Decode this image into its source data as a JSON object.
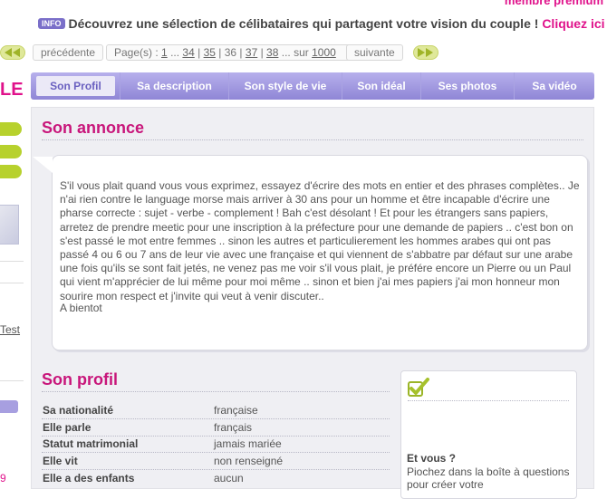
{
  "header": {
    "member_label": "membre premium"
  },
  "promo": {
    "badge": "INFO",
    "text": "Découvrez une sélection de célibataires qui partagent votre vision du couple ! ",
    "link": "Cliquez ici"
  },
  "pager": {
    "prev": "précédente",
    "pages_label": "Page(s) : ",
    "pages": [
      "1",
      "...",
      "34",
      "35",
      "36",
      "37",
      "38",
      "..."
    ],
    "of_label": "sur",
    "total": "1000",
    "next": "suivante"
  },
  "sidebar": {
    "title_fragment": "LE",
    "test_link": "Test",
    "number_fragment": "9"
  },
  "tabs": [
    {
      "label": "Son Profil",
      "active": true
    },
    {
      "label": "Sa description"
    },
    {
      "label": "Son style de vie"
    },
    {
      "label": "Son idéal"
    },
    {
      "label": "Ses photos"
    },
    {
      "label": "Sa vidéo"
    }
  ],
  "annonce": {
    "heading": "Son annonce",
    "text": "S'il vous plait quand vous vous exprimez, essayez d'écrire des mots en entier et des phrases complètes.. Je n'ai rien contre le language morse mais arriver à 30 ans pour un homme et être incapable d'écrire une pharse correcte : sujet - verbe - complement ! Bah c'est désolant ! Et pour les étrangers sans papiers, arretez de prendre meetic pour une inscription à la préfecture pour une demande de papiers .. c'est bon on s'est passé le mot entre femmes .. sinon les autres et particulierement les hommes arabes qui ont pas passé 4 ou 6 ou 7 ans de leur vie avec une française et qui viennent de s'abbatre par défaut sur une arabe une fois qu'ils se sont fait jetés, ne venez pas me voir s'il vous plait, je préfére encore un Pierre ou un Paul qui vient m'apprécier de lui même pour moi même .. sinon et bien j'ai mes papiers j'ai mon honneur mon sourire mon respect et j'invite qui veut à venir discuter..",
    "signoff": "A bientot"
  },
  "profil": {
    "heading": "Son profil",
    "rows": [
      {
        "label": "Sa nationalité",
        "value": "française"
      },
      {
        "label": "Elle parle",
        "value": "français"
      },
      {
        "label": "Statut matrimonial",
        "value": "jamais mariée"
      },
      {
        "label": "Elle vit",
        "value": "non renseigné"
      },
      {
        "label": "Elle a des enfants",
        "value": "aucun"
      }
    ]
  },
  "compare_box": {
    "title": "Et vous ?",
    "text": "Piochez dans la boîte à questions pour créer votre"
  },
  "colors": {
    "accent_pink": "#e0128b",
    "tab_purple": "#8f86d6",
    "lime": "#b7d12d"
  }
}
